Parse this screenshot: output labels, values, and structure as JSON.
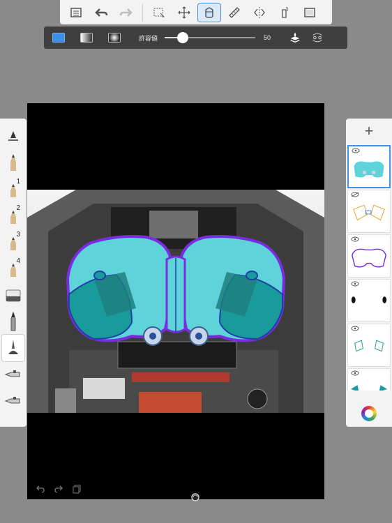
{
  "fill_bar": {
    "tolerance_label": "許容値",
    "tolerance_value": "50",
    "tolerance_level": 0.2
  },
  "icons": {
    "toolbar": [
      "list-icon",
      "undo-icon",
      "redo-icon",
      "selection-icon",
      "transform-icon",
      "fill-icon",
      "ruler-icon",
      "symmetry-icon",
      "perspective-icon",
      "fullscreen-icon"
    ],
    "brushes": [
      "brush-settings-icon",
      "pencil-icon",
      "pencil-1-icon",
      "pencil-2-icon",
      "pencil-3-icon",
      "pencil-4-icon",
      "eraser-icon",
      "pen-icon",
      "fill-brush-icon",
      "airbrush-icon",
      "airbrush-2-icon"
    ],
    "canvas": [
      "canvas-undo-icon",
      "canvas-redo-icon",
      "canvas-copy-icon"
    ]
  },
  "brush_numbers": [
    "1",
    "2",
    "3",
    "4"
  ],
  "layers": {
    "add_label": "+",
    "count": 6
  },
  "colors": {
    "accent": "#3d8fe6",
    "shape_fill": "#5ed3da",
    "shape_dark": "#1a9b9b",
    "outline": "#7a2ce0"
  }
}
